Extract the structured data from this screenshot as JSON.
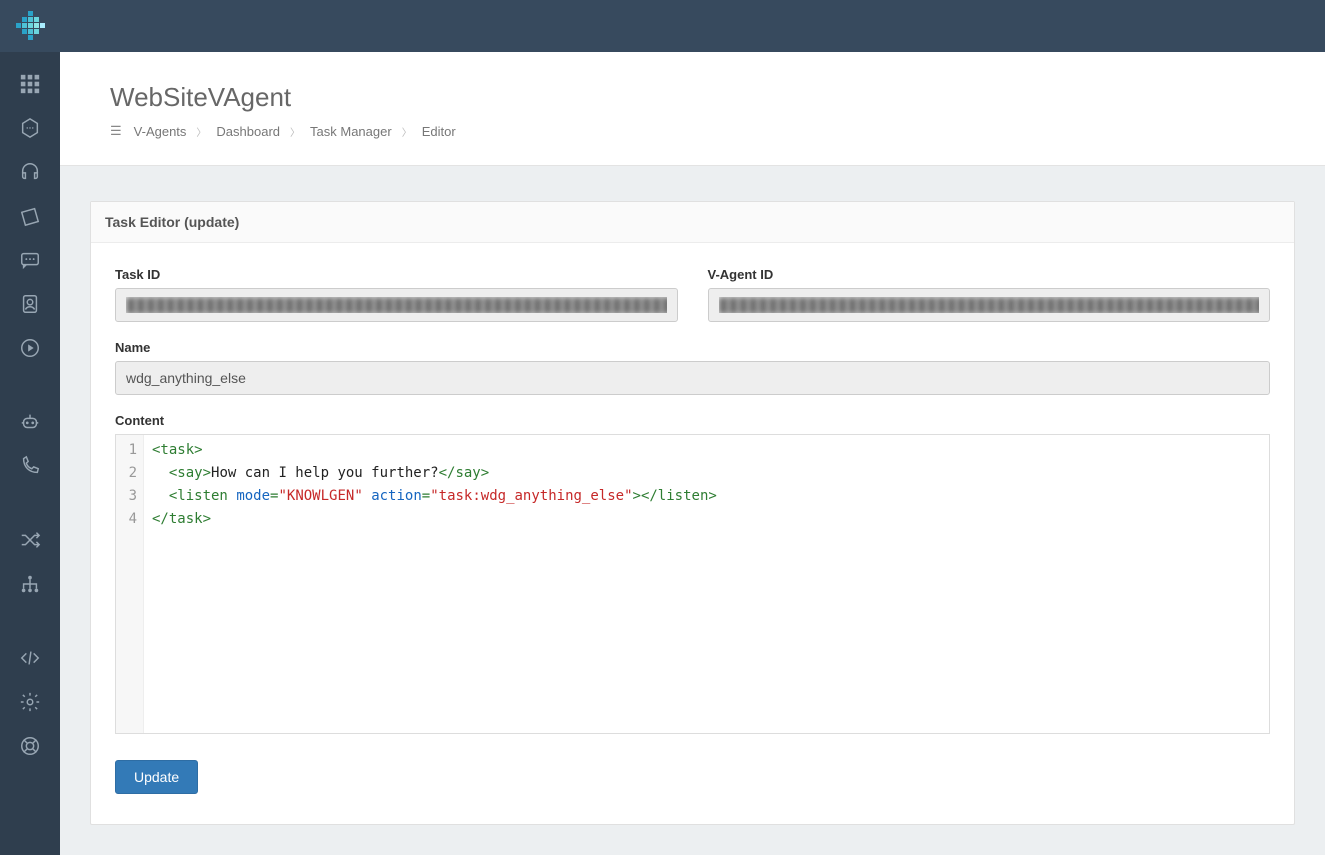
{
  "header": {
    "title": "WebSiteVAgent"
  },
  "breadcrumb": {
    "root": "V-Agents",
    "items": [
      "Dashboard",
      "Task Manager",
      "Editor"
    ]
  },
  "panel": {
    "title": "Task Editor (update)"
  },
  "form": {
    "task_id_label": "Task ID",
    "task_id_value": "████████████████████████████████████████████████████████",
    "vagent_id_label": "V-Agent ID",
    "vagent_id_value": "████████████████████████████████████████████████████████",
    "name_label": "Name",
    "name_value": "wdg_anything_else",
    "content_label": "Content"
  },
  "code": {
    "lines": [
      "1",
      "2",
      "3",
      "4"
    ],
    "l1_open": "<task>",
    "l2_open": "<say>",
    "l2_text": "How can I help you further?",
    "l2_close": "</say>",
    "l3_open": "<listen",
    "l3_attr1": "mode",
    "l3_val1": "\"KNOWLGEN\"",
    "l3_attr2": "action",
    "l3_val2": "\"task:wdg_anything_else\"",
    "l3_gt": ">",
    "l3_close": "</listen>",
    "l4_close": "</task>"
  },
  "buttons": {
    "update": "Update"
  },
  "sidebar": {
    "icons": [
      "apps",
      "hexagon",
      "headset",
      "ticket",
      "chat",
      "contact",
      "play",
      "robot",
      "phone",
      "shuffle",
      "sitemap",
      "code",
      "gear",
      "life-ring"
    ]
  }
}
